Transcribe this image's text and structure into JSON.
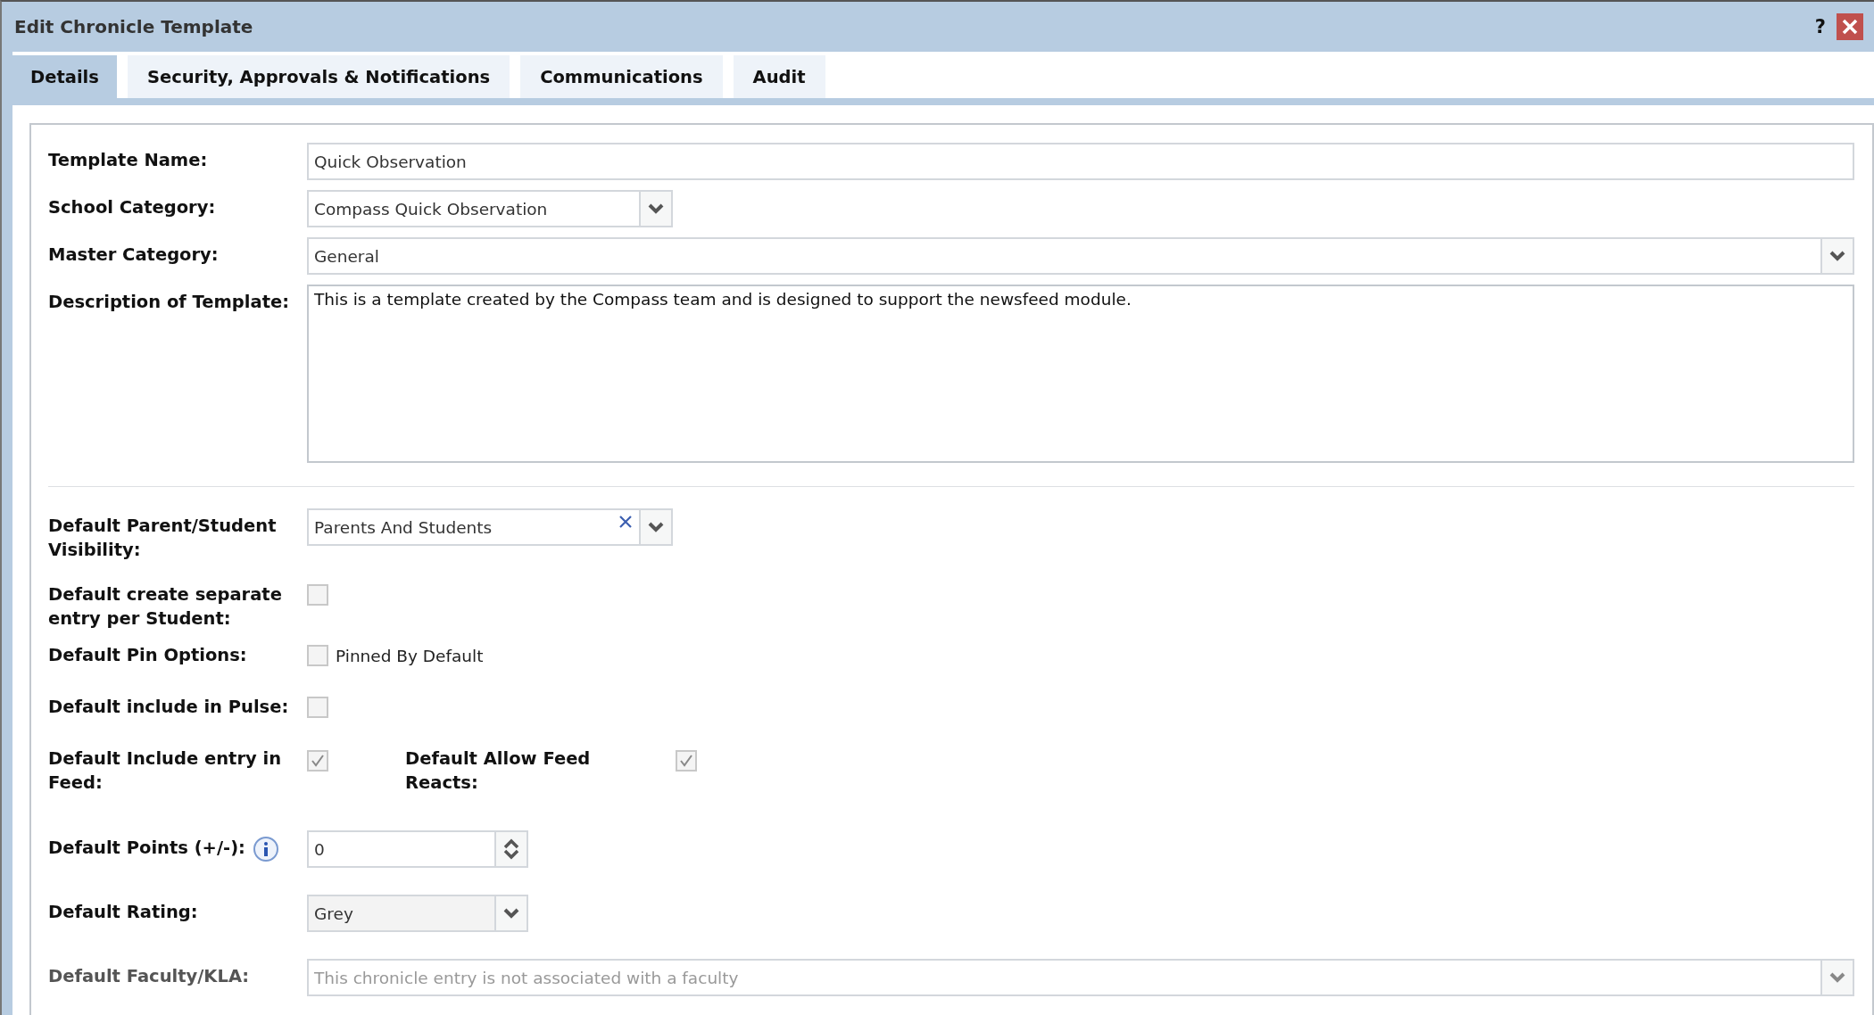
{
  "window": {
    "title": "Edit Chronicle Template",
    "help": "?"
  },
  "tabs": [
    {
      "label": "Details",
      "selected": true
    },
    {
      "label": "Security, Approvals & Notifications",
      "selected": false
    },
    {
      "label": "Communications",
      "selected": false
    },
    {
      "label": "Audit",
      "selected": false
    }
  ],
  "general_fields": [
    {
      "kind": "text",
      "label": "Template Name:",
      "value": "Quick Observation"
    },
    {
      "kind": "select_short",
      "label": "School Category:",
      "value": "Compass Quick Observation"
    },
    {
      "kind": "select",
      "label": "Master Category:",
      "value": "General"
    },
    {
      "kind": "textarea",
      "label": "Description of Template:",
      "value": "This is a template created by the Compass team and is designed to support the newsfeed module."
    }
  ],
  "default_fields": [
    {
      "kind": "multiselect",
      "label": "Default Parent/Student Visibility:",
      "value": "Parents And Students",
      "disabled": false
    },
    {
      "kind": "checkbox",
      "label": "Default create separate entry per Student:",
      "checked": false,
      "disabled": false
    },
    {
      "kind": "checkbox",
      "label": "Default Pin Options:",
      "checked": false,
      "option_label": "Pinned By Default",
      "disabled": false
    },
    {
      "kind": "checkbox",
      "label": "Default include in Pulse:",
      "checked": false,
      "disabled": false
    },
    {
      "kind": "checkbox_pair",
      "label": "Default Include entry in Feed:",
      "checked": true,
      "second_label": "Default Allow Feed Reacts:",
      "second_checked": true,
      "disabled": false
    },
    {
      "kind": "number",
      "label": "Default Points (+/-):",
      "value": "0",
      "info": true,
      "disabled": false
    },
    {
      "kind": "select_short_grey",
      "label": "Default Rating:",
      "value": "Grey",
      "disabled": false
    },
    {
      "kind": "select",
      "label": "Default Faculty/KLA:",
      "placeholder": "This chronicle entry is not associated with a faculty",
      "disabled": true
    }
  ]
}
